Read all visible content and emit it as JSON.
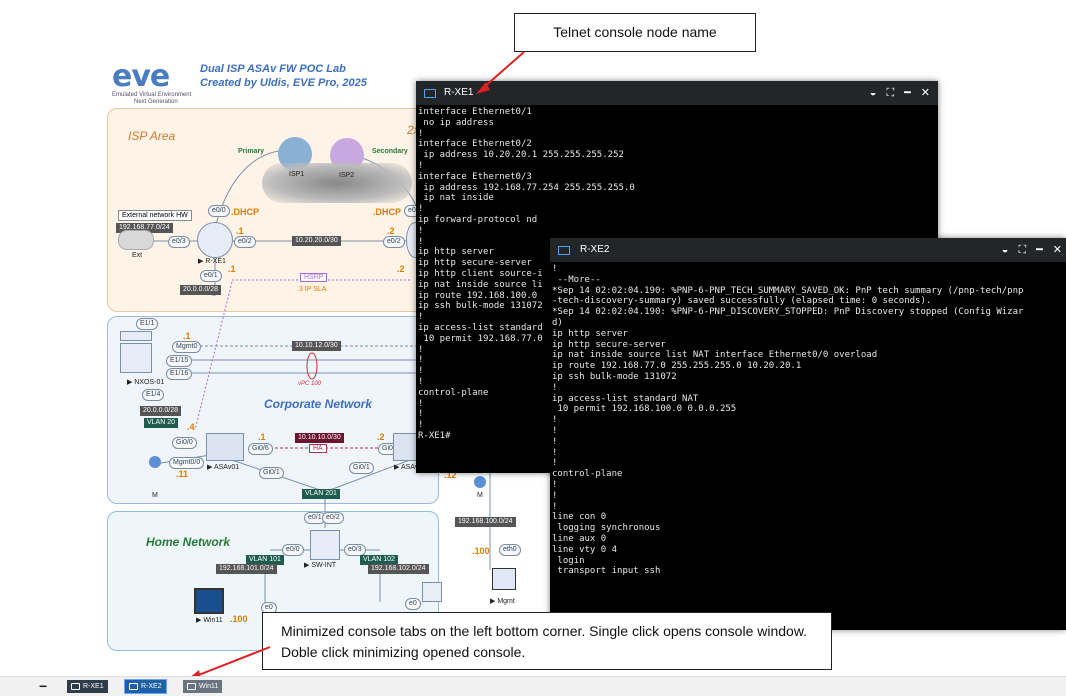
{
  "diagram": {
    "logo": "eve",
    "logo_sub": "Emulated Virtual Environment",
    "logo_sub2": "Next Generation",
    "title_line1": "Dual ISP ASAv FW POC Lab",
    "title_line2": "Created by Uldis, EVE Pro, 2025",
    "isp_area": "ISP Area",
    "isp_2x": "2x",
    "primary": "Primary",
    "secondary": "Secondary",
    "isp1": "ISP1",
    "isp2": "ISP2",
    "e0_0_a": "e0/0",
    "dhcp_a": ".DHCP",
    "dhcp_b": ".DHCP",
    "e0_0_b": "e0/0",
    "ext_hw": "External network HW",
    "ext_net": "192.168.77.0/24",
    "e0_3": "e0/3",
    "ext": "Ext",
    "rxe1": "R-XE1",
    "dot1_a": ".1",
    "e0_2_a": "e0/2",
    "link_10_20": "10.20.20.0/30",
    "dot2_a": ".2",
    "e0_2_b": "e0/2",
    "e0_1": "e0/1",
    "dot1_b": ".1",
    "dot2_b": ".2",
    "net_20": "20.0.0.0/28",
    "hsrp": "HSRP",
    "ip_sla": ".3 IP SLA",
    "e1_1": "E1/1",
    "mgmt0": "Mgmt0",
    "dot1_c": ".1",
    "e1_15": "E1/15",
    "e1_16": "E1/16",
    "nxos": "NXOS-01",
    "link_10_12": "10.10.12.0/30",
    "vpc": "vPC 100",
    "corp": "Corporate Network",
    "e1_4": "E1/4",
    "net_20b": "20.0.0.0/28",
    "vlan20": "VLAN 20",
    "dot4": ".4",
    "gi0_0": "Gi0/0",
    "dot1_d": ".1",
    "gi0_6_a": "Gi0/6",
    "link_10_10": "10.10.10.0/30",
    "ha": "HA",
    "dot2_d": ".2",
    "gi0_6_b": "Gi0/6",
    "mgmt0_0": "Mgmt0/0",
    "dot11": ".11",
    "asav01": "ASAv01",
    "gi0_1_a": "Gi0/1",
    "gi0_1_b": "Gi0/1",
    "asav02": "ASAv",
    "dot12": ".12",
    "m_a": "M",
    "m_b": "M",
    "vlan201": "VLAN 201",
    "e0_1b": "e0/1",
    "e0_2c": "e0/2",
    "home": "Home Network",
    "e0_0_c": "e0/0",
    "e0_3b": "e0/3",
    "net_100": "192.168.100.0/24",
    "vlan101": "VLAN 101",
    "net_101": "192.168.101.0/24",
    "swint": "SW-INT",
    "vlan102": "VLAN 102",
    "net_102": "192.168.102.0/24",
    "dot100_a": ".100",
    "eth0": "eth0",
    "e0_a": "e0",
    "e0_b": "e0",
    "win11": "Win11",
    "dot100_b": ".100",
    "mgmt": "Mgmt"
  },
  "console1": {
    "title": "R-XE1",
    "lines": "interface Ethernet0/1\n no ip address\n!\ninterface Ethernet0/2\n ip address 10.20.20.1 255.255.255.252\n!\ninterface Ethernet0/3\n ip address 192.168.77.254 255.255.255.0\n ip nat inside\n!\nip forward-protocol nd\n!\n!\nip http server\nip http secure-server\nip http client source-i\nip nat inside source li\nip route 192.168.100.0\nip ssh bulk-mode 131072\n!\nip access-list standard\n 10 permit 192.168.77.0\n!\n!\n!\n!\ncontrol-plane\n!\n!\n!\nR-XE1#"
  },
  "console2": {
    "title": "R-XE2",
    "lines": "!\n --More--\n*Sep 14 02:02:04.190: %PNP-6-PNP_TECH_SUMMARY_SAVED_OK: PnP tech summary (/pnp-tech/pnp\n-tech-discovery-summary) saved successfully (elapsed time: 0 seconds).\n*Sep 14 02:02:04.190: %PNP-6-PNP_DISCOVERY_STOPPED: PnP Discovery stopped (Config Wizar\nd)\nip http server\nip http secure-server\nip nat inside source list NAT interface Ethernet0/0 overload\nip route 192.168.77.0 255.255.255.0 10.20.20.1\nip ssh bulk-mode 131072\n!\nip access-list standard NAT\n 10 permit 192.168.100.0 0.0.0.255\n!\n!\n!\n!\n!\ncontrol-plane\n!\n!\n!\nline con 0\n logging synchronous\nline aux 0\nline vty 0 4\n login\n transport input ssh"
  },
  "callouts": {
    "top": "Telnet console node name",
    "bottom": "Minimized console tabs on the left bottom corner. Single click opens console window. Doble click minimizing opened console."
  },
  "taskbar": {
    "collapse": "−",
    "tabs": [
      "R-XE1",
      "R-XE2",
      "Win11"
    ]
  },
  "colors": {
    "accent": "#1d5fa8",
    "arrow": "#e02020",
    "orange": "#e07b00"
  }
}
